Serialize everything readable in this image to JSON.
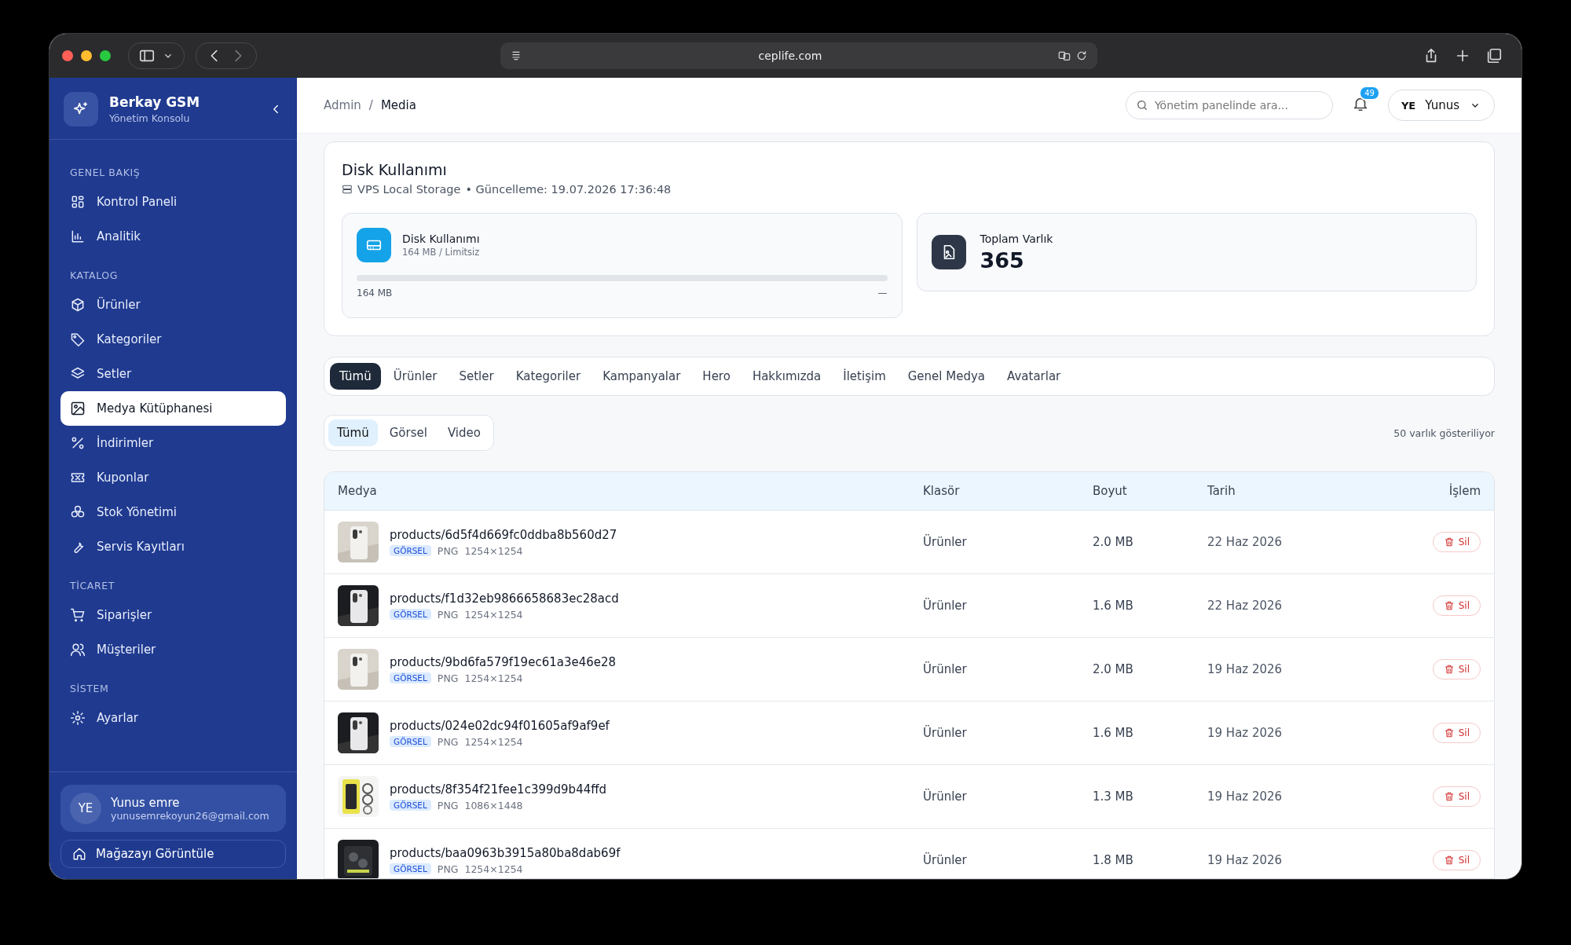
{
  "browser": {
    "url": "ceplife.com"
  },
  "sidebar": {
    "brand": "Berkay GSM",
    "subtitle": "Yönetim Konsolu",
    "sections": [
      {
        "title": "GENEL BAKIŞ",
        "items": [
          {
            "label": "Kontrol Paneli",
            "selected": false
          },
          {
            "label": "Analitik",
            "selected": false
          }
        ]
      },
      {
        "title": "KATALOG",
        "items": [
          {
            "label": "Ürünler",
            "selected": false
          },
          {
            "label": "Kategoriler",
            "selected": false
          },
          {
            "label": "Setler",
            "selected": false
          },
          {
            "label": "Medya Kütüphanesi",
            "selected": true
          },
          {
            "label": "İndirimler",
            "selected": false
          },
          {
            "label": "Kuponlar",
            "selected": false
          },
          {
            "label": "Stok Yönetimi",
            "selected": false
          },
          {
            "label": "Servis Kayıtları",
            "selected": false
          }
        ]
      },
      {
        "title": "TİCARET",
        "items": [
          {
            "label": "Siparişler",
            "selected": false
          },
          {
            "label": "Müşteriler",
            "selected": false
          }
        ]
      },
      {
        "title": "SİSTEM",
        "items": [
          {
            "label": "Ayarlar",
            "selected": false
          }
        ]
      }
    ],
    "user": {
      "initials": "YE",
      "name": "Yunus emre",
      "email": "yunusemrekoyun26@gmail.com"
    },
    "store_link": "Mağazayı Görüntüle"
  },
  "header": {
    "breadcrumb": [
      "Admin",
      "Media"
    ],
    "breadcrumb_separator": "/",
    "search": {
      "placeholder": "Yönetim panelinde ara..."
    },
    "notifications": "49",
    "user": {
      "initials": "YE",
      "name": "Yunus"
    }
  },
  "disk": {
    "title": "Disk Kullanımı",
    "storage": "VPS Local Storage",
    "updated": "• Güncelleme: 19.07.2026 17:36:48",
    "usage": {
      "title": "Disk Kullanımı",
      "subtitle": "164 MB / Limitsiz",
      "level": 0,
      "used": "164 MB",
      "limit": "—"
    },
    "total": {
      "label": "Toplam Varlık",
      "value": "365"
    }
  },
  "tabs": [
    {
      "label": "Tümü",
      "selected": true
    },
    {
      "label": "Ürünler",
      "selected": false
    },
    {
      "label": "Setler",
      "selected": false
    },
    {
      "label": "Kategoriler",
      "selected": false
    },
    {
      "label": "Kampanyalar",
      "selected": false
    },
    {
      "label": "Hero",
      "selected": false
    },
    {
      "label": "Hakkımızda",
      "selected": false
    },
    {
      "label": "İletişim",
      "selected": false
    },
    {
      "label": "Genel Medya",
      "selected": false
    },
    {
      "label": "Avatarlar",
      "selected": false
    }
  ],
  "type_filter": [
    {
      "label": "Tümü",
      "selected": true
    },
    {
      "label": "Görsel",
      "selected": false
    },
    {
      "label": "Video",
      "selected": false
    }
  ],
  "count": "50 varlık gösteriliyor",
  "table": {
    "columns": [
      "Medya",
      "Klasör",
      "Boyut",
      "Tarih",
      "İşlem"
    ],
    "rows": [
      {
        "path": "products/6d5f4d669fc0ddba8b560d27",
        "badge": "GÖRSEL",
        "format": "PNG",
        "dimensions": "1254×1254",
        "folder": "Ürünler",
        "size": "2.0 MB",
        "date": "22 Haz 2026",
        "action": "Sil"
      },
      {
        "path": "products/f1d32eb9866658683ec28acd",
        "badge": "GÖRSEL",
        "format": "PNG",
        "dimensions": "1254×1254",
        "folder": "Ürünler",
        "size": "1.6 MB",
        "date": "22 Haz 2026",
        "action": "Sil"
      },
      {
        "path": "products/9bd6fa579f19ec61a3e46e28",
        "badge": "GÖRSEL",
        "format": "PNG",
        "dimensions": "1254×1254",
        "folder": "Ürünler",
        "size": "2.0 MB",
        "date": "19 Haz 2026",
        "action": "Sil"
      },
      {
        "path": "products/024e02dc94f01605af9af9ef",
        "badge": "GÖRSEL",
        "format": "PNG",
        "dimensions": "1254×1254",
        "folder": "Ürünler",
        "size": "1.6 MB",
        "date": "19 Haz 2026",
        "action": "Sil"
      },
      {
        "path": "products/8f354f21fee1c399d9b44ffd",
        "badge": "GÖRSEL",
        "format": "PNG",
        "dimensions": "1086×1448",
        "folder": "Ürünler",
        "size": "1.3 MB",
        "date": "19 Haz 2026",
        "action": "Sil"
      },
      {
        "path": "products/baa0963b3915a80ba8dab69f",
        "badge": "GÖRSEL",
        "format": "PNG",
        "dimensions": "1254×1254",
        "folder": "Ürünler",
        "size": "1.8 MB",
        "date": "19 Haz 2026",
        "action": "Sil"
      }
    ]
  }
}
